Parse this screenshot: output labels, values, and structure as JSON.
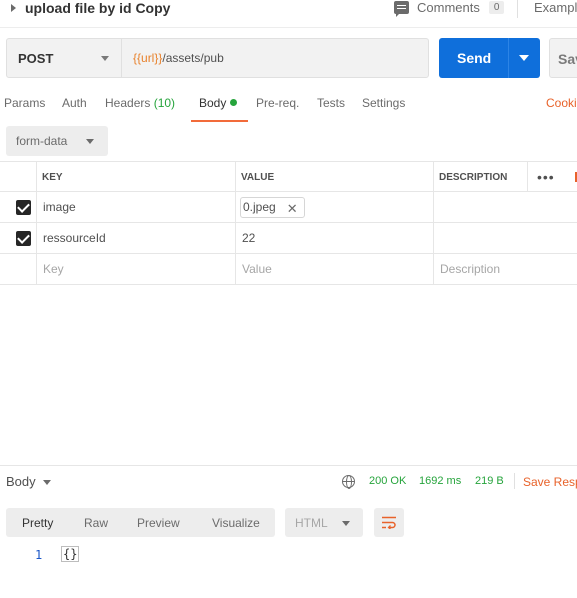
{
  "title": {
    "request_name": "upload file by id Copy",
    "comments_label": "Comments",
    "comments_count": "0",
    "examples_label": "Exampl"
  },
  "url_bar": {
    "method": "POST",
    "url_variable": "{{url}}",
    "url_path": "/assets/pub",
    "send_label": "Send",
    "save_label": "Save"
  },
  "tabs": [
    {
      "label": "Params"
    },
    {
      "label": "Auth"
    },
    {
      "label": "Headers",
      "count": "(10)"
    },
    {
      "label": "Body",
      "active": true
    },
    {
      "label": "Pre-req."
    },
    {
      "label": "Tests"
    },
    {
      "label": "Settings"
    },
    {
      "label": "Cooki"
    }
  ],
  "body_type": "form-data",
  "table": {
    "headers": {
      "key": "KEY",
      "value": "VALUE",
      "description": "DESCRIPTION"
    },
    "rows": [
      {
        "checked": true,
        "key": "image",
        "value": "0.jpeg",
        "type": "file"
      },
      {
        "checked": true,
        "key": "ressourceId",
        "value": "22",
        "type": "text"
      }
    ],
    "placeholders": {
      "key": "Key",
      "value": "Value",
      "description": "Description"
    }
  },
  "response": {
    "section_label": "Body",
    "status": "200 OK",
    "time": "1692 ms",
    "size": "219 B",
    "save_label": "Save Resp",
    "view_tabs": [
      "Pretty",
      "Raw",
      "Preview",
      "Visualize"
    ],
    "active_view": "Pretty",
    "language": "HTML",
    "line_number": "1",
    "code": "{}"
  },
  "colors": {
    "send_button": "#0f6fdb",
    "accent": "#f26b3a",
    "status_ok": "#26a43c",
    "url_variable": "#e8812b"
  }
}
